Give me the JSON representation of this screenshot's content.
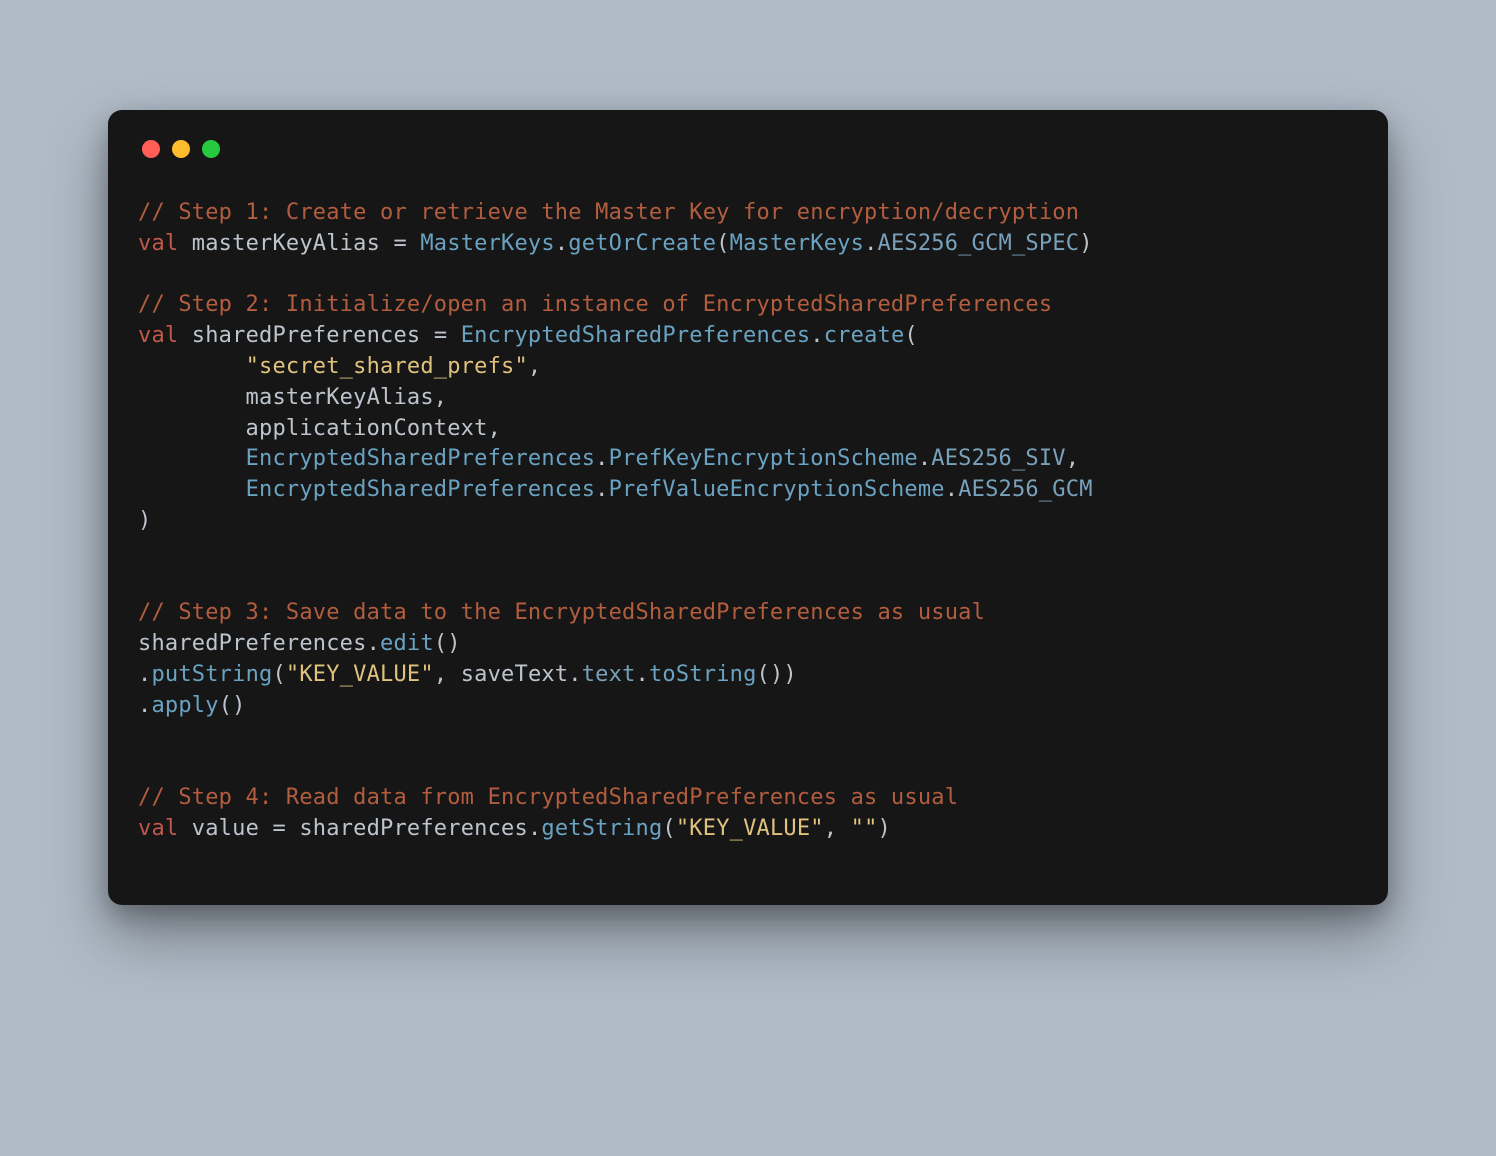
{
  "colors": {
    "background_page": "#b0bbc7",
    "background_window": "#161616",
    "traffic_red": "#ff5f56",
    "traffic_yellow": "#ffbd2e",
    "traffic_green": "#27c93f",
    "comment": "#b35d3f",
    "keyword": "#c0584b",
    "identifier": "#bdc4cc",
    "type_method": "#6aa3c2",
    "string": "#e0c27e"
  },
  "code": {
    "tokens": [
      [
        [
          "comment",
          "// Step 1: Create or retrieve the Master Key for encryption/decryption"
        ]
      ],
      [
        [
          "keyword",
          "val"
        ],
        [
          "ident",
          " masterKeyAlias "
        ],
        [
          "punct",
          "= "
        ],
        [
          "type",
          "MasterKeys"
        ],
        [
          "punct",
          "."
        ],
        [
          "method",
          "getOrCreate"
        ],
        [
          "punct",
          "("
        ],
        [
          "type",
          "MasterKeys"
        ],
        [
          "punct",
          "."
        ],
        [
          "const",
          "AES256_GCM_SPEC"
        ],
        [
          "punct",
          ")"
        ]
      ],
      [],
      [
        [
          "comment",
          "// Step 2: Initialize/open an instance of EncryptedSharedPreferences"
        ]
      ],
      [
        [
          "keyword",
          "val"
        ],
        [
          "ident",
          " sharedPreferences "
        ],
        [
          "punct",
          "= "
        ],
        [
          "type",
          "EncryptedSharedPreferences"
        ],
        [
          "punct",
          "."
        ],
        [
          "method",
          "create"
        ],
        [
          "punct",
          "("
        ]
      ],
      [
        [
          "ident",
          "        "
        ],
        [
          "string",
          "\"secret_shared_prefs\""
        ],
        [
          "punct",
          ","
        ]
      ],
      [
        [
          "ident",
          "        masterKeyAlias"
        ],
        [
          "punct",
          ","
        ]
      ],
      [
        [
          "ident",
          "        applicationContext"
        ],
        [
          "punct",
          ","
        ]
      ],
      [
        [
          "ident",
          "        "
        ],
        [
          "type",
          "EncryptedSharedPreferences"
        ],
        [
          "punct",
          "."
        ],
        [
          "type",
          "PrefKeyEncryptionScheme"
        ],
        [
          "punct",
          "."
        ],
        [
          "const",
          "AES256_SIV"
        ],
        [
          "punct",
          ","
        ]
      ],
      [
        [
          "ident",
          "        "
        ],
        [
          "type",
          "EncryptedSharedPreferences"
        ],
        [
          "punct",
          "."
        ],
        [
          "type",
          "PrefValueEncryptionScheme"
        ],
        [
          "punct",
          "."
        ],
        [
          "const",
          "AES256_GCM"
        ]
      ],
      [
        [
          "punct",
          ")"
        ]
      ],
      [],
      [],
      [
        [
          "comment",
          "// Step 3: Save data to the EncryptedSharedPreferences as usual"
        ]
      ],
      [
        [
          "ident",
          "sharedPreferences"
        ],
        [
          "punct",
          "."
        ],
        [
          "method",
          "edit"
        ],
        [
          "punct",
          "()"
        ]
      ],
      [
        [
          "punct",
          "."
        ],
        [
          "method",
          "putString"
        ],
        [
          "punct",
          "("
        ],
        [
          "string",
          "\"KEY_VALUE\""
        ],
        [
          "punct",
          ", "
        ],
        [
          "ident",
          "saveText"
        ],
        [
          "punct",
          "."
        ],
        [
          "prop",
          "text"
        ],
        [
          "punct",
          "."
        ],
        [
          "method",
          "toString"
        ],
        [
          "punct",
          "())"
        ]
      ],
      [
        [
          "punct",
          "."
        ],
        [
          "method",
          "apply"
        ],
        [
          "punct",
          "()"
        ]
      ],
      [],
      [],
      [
        [
          "comment",
          "// Step 4: Read data from EncryptedSharedPreferences as usual"
        ]
      ],
      [
        [
          "keyword",
          "val"
        ],
        [
          "ident",
          " value "
        ],
        [
          "punct",
          "= "
        ],
        [
          "ident",
          "sharedPreferences"
        ],
        [
          "punct",
          "."
        ],
        [
          "method",
          "getString"
        ],
        [
          "punct",
          "("
        ],
        [
          "string",
          "\"KEY_VALUE\""
        ],
        [
          "punct",
          ", "
        ],
        [
          "string",
          "\"\""
        ],
        [
          "punct",
          ")"
        ]
      ]
    ]
  }
}
